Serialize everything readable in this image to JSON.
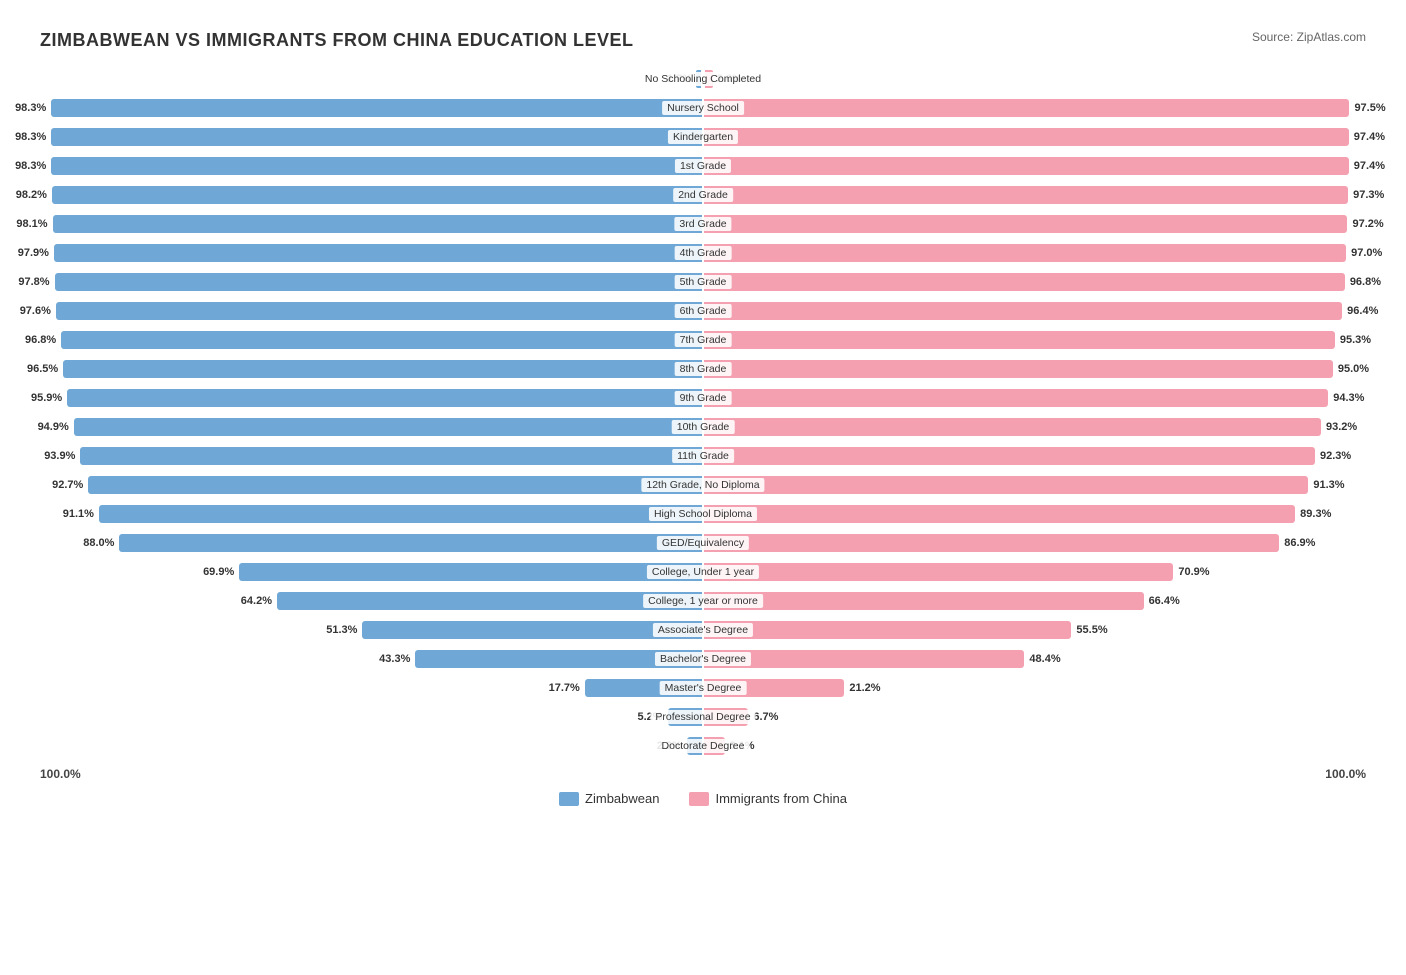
{
  "title": "ZIMBABWEAN VS IMMIGRANTS FROM CHINA EDUCATION LEVEL",
  "source": "Source: ZipAtlas.com",
  "colors": {
    "blue": "#6fa8d6",
    "pink": "#f4a0b0"
  },
  "legend": {
    "blue_label": "Zimbabwean",
    "pink_label": "Immigrants from China"
  },
  "axis": {
    "left": "100.0%",
    "right": "100.0%"
  },
  "rows": [
    {
      "label": "No Schooling Completed",
      "left_val": "1.7%",
      "left_pct": 1.7,
      "right_val": "2.6%",
      "right_pct": 2.6,
      "special": true
    },
    {
      "label": "Nursery School",
      "left_val": "98.3%",
      "left_pct": 98.3,
      "right_val": "97.5%",
      "right_pct": 97.5
    },
    {
      "label": "Kindergarten",
      "left_val": "98.3%",
      "left_pct": 98.3,
      "right_val": "97.4%",
      "right_pct": 97.4
    },
    {
      "label": "1st Grade",
      "left_val": "98.3%",
      "left_pct": 98.3,
      "right_val": "97.4%",
      "right_pct": 97.4
    },
    {
      "label": "2nd Grade",
      "left_val": "98.2%",
      "left_pct": 98.2,
      "right_val": "97.3%",
      "right_pct": 97.3
    },
    {
      "label": "3rd Grade",
      "left_val": "98.1%",
      "left_pct": 98.1,
      "right_val": "97.2%",
      "right_pct": 97.2
    },
    {
      "label": "4th Grade",
      "left_val": "97.9%",
      "left_pct": 97.9,
      "right_val": "97.0%",
      "right_pct": 97.0
    },
    {
      "label": "5th Grade",
      "left_val": "97.8%",
      "left_pct": 97.8,
      "right_val": "96.8%",
      "right_pct": 96.8
    },
    {
      "label": "6th Grade",
      "left_val": "97.6%",
      "left_pct": 97.6,
      "right_val": "96.4%",
      "right_pct": 96.4
    },
    {
      "label": "7th Grade",
      "left_val": "96.8%",
      "left_pct": 96.8,
      "right_val": "95.3%",
      "right_pct": 95.3
    },
    {
      "label": "8th Grade",
      "left_val": "96.5%",
      "left_pct": 96.5,
      "right_val": "95.0%",
      "right_pct": 95.0
    },
    {
      "label": "9th Grade",
      "left_val": "95.9%",
      "left_pct": 95.9,
      "right_val": "94.3%",
      "right_pct": 94.3
    },
    {
      "label": "10th Grade",
      "left_val": "94.9%",
      "left_pct": 94.9,
      "right_val": "93.2%",
      "right_pct": 93.2
    },
    {
      "label": "11th Grade",
      "left_val": "93.9%",
      "left_pct": 93.9,
      "right_val": "92.3%",
      "right_pct": 92.3
    },
    {
      "label": "12th Grade, No Diploma",
      "left_val": "92.7%",
      "left_pct": 92.7,
      "right_val": "91.3%",
      "right_pct": 91.3
    },
    {
      "label": "High School Diploma",
      "left_val": "91.1%",
      "left_pct": 91.1,
      "right_val": "89.3%",
      "right_pct": 89.3
    },
    {
      "label": "GED/Equivalency",
      "left_val": "88.0%",
      "left_pct": 88.0,
      "right_val": "86.9%",
      "right_pct": 86.9
    },
    {
      "label": "College, Under 1 year",
      "left_val": "69.9%",
      "left_pct": 69.9,
      "right_val": "70.9%",
      "right_pct": 70.9
    },
    {
      "label": "College, 1 year or more",
      "left_val": "64.2%",
      "left_pct": 64.2,
      "right_val": "66.4%",
      "right_pct": 66.4
    },
    {
      "label": "Associate's Degree",
      "left_val": "51.3%",
      "left_pct": 51.3,
      "right_val": "55.5%",
      "right_pct": 55.5
    },
    {
      "label": "Bachelor's Degree",
      "left_val": "43.3%",
      "left_pct": 43.3,
      "right_val": "48.4%",
      "right_pct": 48.4
    },
    {
      "label": "Master's Degree",
      "left_val": "17.7%",
      "left_pct": 17.7,
      "right_val": "21.2%",
      "right_pct": 21.2
    },
    {
      "label": "Professional Degree",
      "left_val": "5.2%",
      "left_pct": 5.2,
      "right_val": "6.7%",
      "right_pct": 6.7
    },
    {
      "label": "Doctorate Degree",
      "left_val": "2.3%",
      "left_pct": 2.3,
      "right_val": "3.1%",
      "right_pct": 3.1
    }
  ]
}
